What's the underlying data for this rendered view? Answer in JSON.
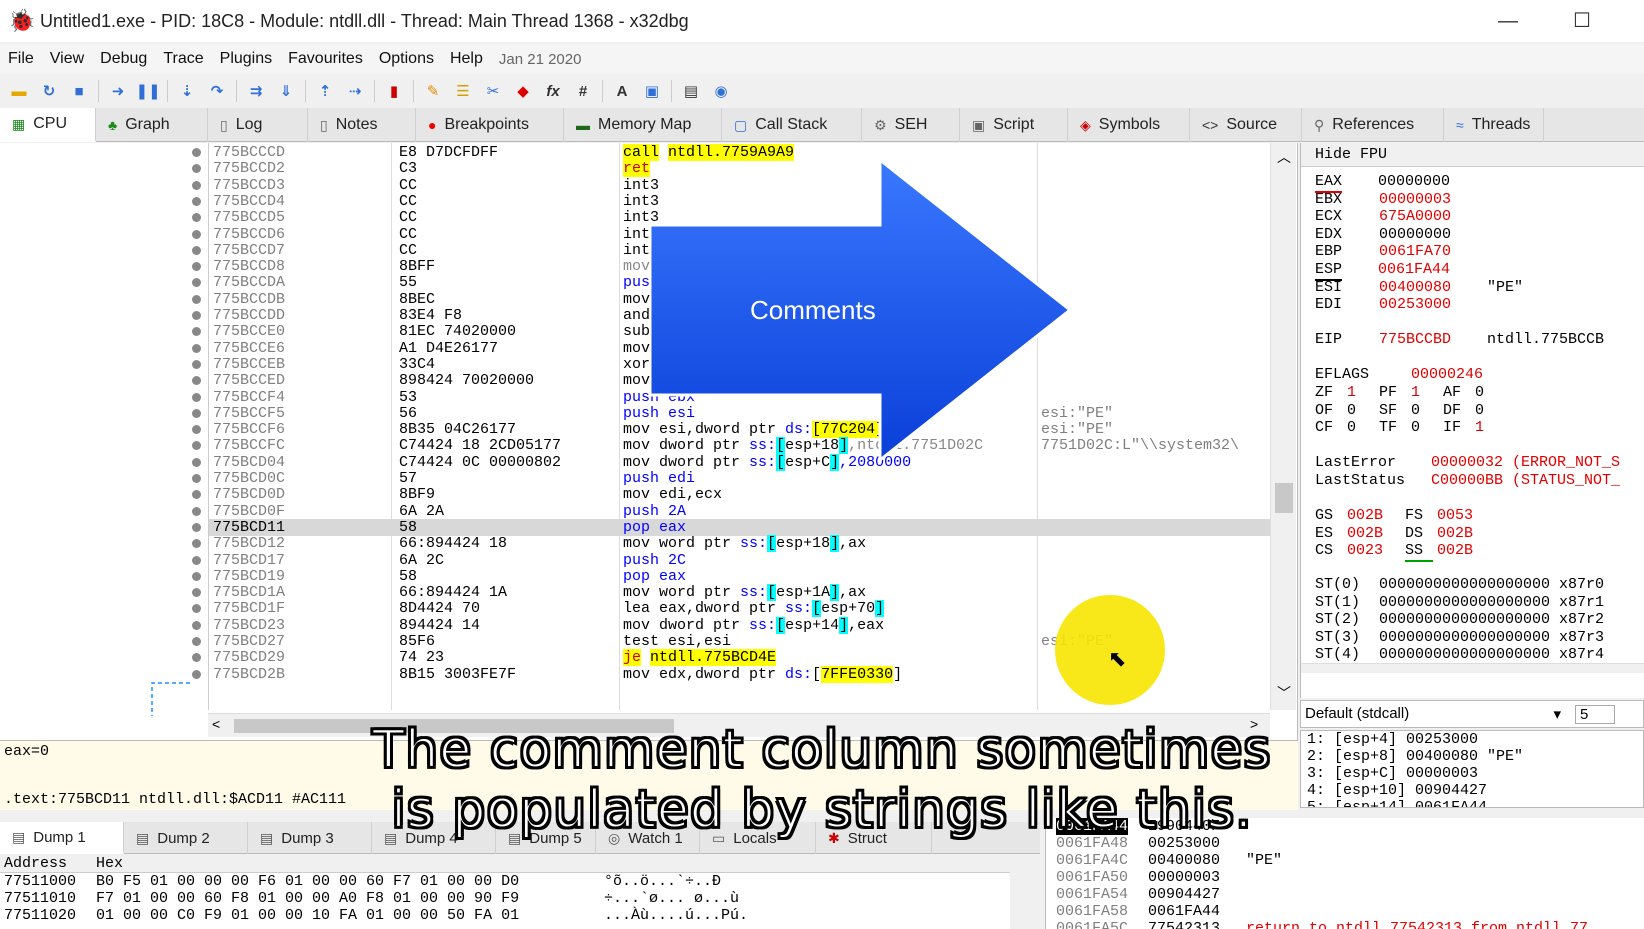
{
  "window": {
    "title": "Untitled1.exe - PID: 18C8 - Module: ntdll.dll - Thread: Main Thread 1368 - x32dbg",
    "minimize": "—",
    "maximize": "☐"
  },
  "menu": {
    "items": [
      "File",
      "View",
      "Debug",
      "Trace",
      "Plugins",
      "Favourites",
      "Options",
      "Help"
    ],
    "date": "Jan 21 2020"
  },
  "toolbar": {
    "fx": "fx",
    "hash": "#",
    "font": "A"
  },
  "tabs": [
    {
      "label": "CPU",
      "icon": "cpu-icon"
    },
    {
      "label": "Graph",
      "icon": "graph-icon"
    },
    {
      "label": "Log",
      "icon": "log-icon"
    },
    {
      "label": "Notes",
      "icon": "notes-icon"
    },
    {
      "label": "Breakpoints",
      "icon": "breakpoint-icon"
    },
    {
      "label": "Memory Map",
      "icon": "memory-icon"
    },
    {
      "label": "Call Stack",
      "icon": "callstack-icon"
    },
    {
      "label": "SEH",
      "icon": "seh-icon"
    },
    {
      "label": "Script",
      "icon": "script-icon"
    },
    {
      "label": "Symbols",
      "icon": "symbols-icon"
    },
    {
      "label": "Source",
      "icon": "source-icon"
    },
    {
      "label": "References",
      "icon": "references-icon"
    },
    {
      "label": "Threads",
      "icon": "threads-icon"
    }
  ],
  "disasm": {
    "rows": [
      {
        "addr": "775BCCCD",
        "bytes": "E8 D7DCFDFF",
        "instr_parts": [
          {
            "t": "call",
            "c": "kw-call"
          },
          {
            "t": " "
          },
          {
            "t": "ntdll.7759A9A9",
            "c": "hl-yellow"
          }
        ],
        "cmt": ""
      },
      {
        "addr": "775BCCD2",
        "bytes": "C3",
        "instr_parts": [
          {
            "t": "ret",
            "c": "kw-ret"
          }
        ],
        "cmt": ""
      },
      {
        "addr": "775BCCD3",
        "bytes": "CC",
        "instr_parts": [
          {
            "t": "int3"
          }
        ],
        "cmt": ""
      },
      {
        "addr": "775BCCD4",
        "bytes": "CC",
        "instr_parts": [
          {
            "t": "int3"
          }
        ],
        "cmt": ""
      },
      {
        "addr": "775BCCD5",
        "bytes": "CC",
        "instr_parts": [
          {
            "t": "int3"
          }
        ],
        "cmt": ""
      },
      {
        "addr": "775BCCD6",
        "bytes": "CC",
        "instr_parts": [
          {
            "t": "int3"
          }
        ],
        "cmt": ""
      },
      {
        "addr": "775BCCD7",
        "bytes": "CC",
        "instr_parts": [
          {
            "t": "int3"
          }
        ],
        "cmt": ""
      },
      {
        "addr": "775BCCD8",
        "bytes": "8BFF",
        "instr_parts": [
          {
            "t": "mov edi,edi",
            "c": "muted"
          }
        ],
        "cmt": ""
      },
      {
        "addr": "775BCCDA",
        "bytes": "55",
        "instr_parts": [
          {
            "t": "push ebp",
            "c": "kw-push"
          }
        ],
        "cmt": ""
      },
      {
        "addr": "775BCCDB",
        "bytes": "8BEC",
        "instr_parts": [
          {
            "t": "mov ebp,esp"
          }
        ],
        "cmt": ""
      },
      {
        "addr": "775BCCDD",
        "bytes": "83E4 F8",
        "instr_parts": [
          {
            "t": "and esp,FFFFFFF8"
          }
        ],
        "cmt": ""
      },
      {
        "addr": "775BCCE0",
        "bytes": "81EC 74020000",
        "instr_parts": [
          {
            "t": "sub esp,274"
          }
        ],
        "cmt": ""
      },
      {
        "addr": "775BCCE6",
        "bytes": "A1 D4E26177",
        "instr_parts": [
          {
            "t": "mov eax,dword ptr ds:[7761E2D4]"
          }
        ],
        "cmt": ""
      },
      {
        "addr": "775BCCEB",
        "bytes": "33C4",
        "instr_parts": [
          {
            "t": "xor eax,esp"
          }
        ],
        "cmt": ""
      },
      {
        "addr": "775BCCED",
        "bytes": "898424 70020000",
        "instr_parts": [
          {
            "t": "mov dword ptr "
          },
          {
            "t": "ss:",
            "c": "kw-seg"
          },
          {
            "t": "[",
            "c": "bracket"
          },
          {
            "t": "esp+27",
            "c": "kw-seg"
          }
        ],
        "cmt": ""
      },
      {
        "addr": "775BCCF4",
        "bytes": "53",
        "instr_parts": [
          {
            "t": "push ebx",
            "c": "kw-push"
          }
        ],
        "cmt": ""
      },
      {
        "addr": "775BCCF5",
        "bytes": "56",
        "instr_parts": [
          {
            "t": "push esi",
            "c": "kw-push"
          }
        ],
        "cmt": "esi:\"PE\""
      },
      {
        "addr": "775BCCF6",
        "bytes": "8B35 04C26177",
        "instr_parts": [
          {
            "t": "mov esi,dword ptr "
          },
          {
            "t": "ds:",
            "c": "kw-seg"
          },
          {
            "t": "[77",
            "c": "hl-yellow"
          },
          {
            "t": "C204]",
            "c": "hl-yellow"
          }
        ],
        "cmt": "esi:\"PE\""
      },
      {
        "addr": "775BCCFC",
        "bytes": "C74424 18 2CD05177",
        "instr_parts": [
          {
            "t": "mov dword ptr "
          },
          {
            "t": "ss:",
            "c": "kw-seg"
          },
          {
            "t": "[",
            "c": "bracket"
          },
          {
            "t": "esp+18"
          },
          {
            "t": "]",
            "c": "bracket"
          },
          {
            "t": ",ntdll.7751D02C",
            "c": "muted"
          }
        ],
        "cmt": "7751D02C:L\"\\\\system32\\"
      },
      {
        "addr": "775BCD04",
        "bytes": "C74424 0C 00000802",
        "instr_parts": [
          {
            "t": "mov dword ptr "
          },
          {
            "t": "ss:",
            "c": "kw-seg"
          },
          {
            "t": "[",
            "c": "bracket"
          },
          {
            "t": "esp+C"
          },
          {
            "t": "]",
            "c": "bracket"
          },
          {
            "t": ",2080000",
            "c": "kw-seg"
          }
        ],
        "cmt": ""
      },
      {
        "addr": "775BCD0C",
        "bytes": "57",
        "instr_parts": [
          {
            "t": "push edi",
            "c": "kw-push"
          }
        ],
        "cmt": ""
      },
      {
        "addr": "775BCD0D",
        "bytes": "8BF9",
        "instr_parts": [
          {
            "t": "mov edi,ecx"
          }
        ],
        "cmt": ""
      },
      {
        "addr": "775BCD0F",
        "bytes": "6A 2A",
        "instr_parts": [
          {
            "t": "push 2A",
            "c": "kw-push"
          }
        ],
        "cmt": ""
      },
      {
        "addr": "775BCD11",
        "bytes": "58",
        "instr_parts": [
          {
            "t": "pop eax",
            "c": "kw-push"
          }
        ],
        "cmt": "",
        "selected": true
      },
      {
        "addr": "775BCD12",
        "bytes": "66:894424 18",
        "instr_parts": [
          {
            "t": "mov word ptr "
          },
          {
            "t": "ss:",
            "c": "kw-seg"
          },
          {
            "t": "[",
            "c": "bracket"
          },
          {
            "t": "esp+18"
          },
          {
            "t": "]",
            "c": "bracket"
          },
          {
            "t": ",ax"
          }
        ],
        "cmt": ""
      },
      {
        "addr": "775BCD17",
        "bytes": "6A 2C",
        "instr_parts": [
          {
            "t": "push 2C",
            "c": "kw-push"
          }
        ],
        "cmt": ""
      },
      {
        "addr": "775BCD19",
        "bytes": "58",
        "instr_parts": [
          {
            "t": "pop eax",
            "c": "kw-push"
          }
        ],
        "cmt": ""
      },
      {
        "addr": "775BCD1A",
        "bytes": "66:894424 1A",
        "instr_parts": [
          {
            "t": "mov word ptr "
          },
          {
            "t": "ss:",
            "c": "kw-seg"
          },
          {
            "t": "[",
            "c": "bracket"
          },
          {
            "t": "esp+1A"
          },
          {
            "t": "]",
            "c": "bracket"
          },
          {
            "t": ",ax"
          }
        ],
        "cmt": ""
      },
      {
        "addr": "775BCD1F",
        "bytes": "8D4424 70",
        "instr_parts": [
          {
            "t": "lea eax,dword ptr "
          },
          {
            "t": "ss:",
            "c": "kw-seg"
          },
          {
            "t": "[",
            "c": "bracket"
          },
          {
            "t": "esp+70"
          },
          {
            "t": "]",
            "c": "bracket"
          }
        ],
        "cmt": ""
      },
      {
        "addr": "775BCD23",
        "bytes": "894424 14",
        "instr_parts": [
          {
            "t": "mov dword ptr "
          },
          {
            "t": "ss:",
            "c": "kw-seg"
          },
          {
            "t": "[",
            "c": "bracket"
          },
          {
            "t": "esp+14"
          },
          {
            "t": "]",
            "c": "bracket"
          },
          {
            "t": ",eax"
          }
        ],
        "cmt": ""
      },
      {
        "addr": "775BCD27",
        "bytes": "85F6",
        "instr_parts": [
          {
            "t": "test esi,esi"
          }
        ],
        "cmt": "esi:\"PE\""
      },
      {
        "addr": "775BCD29",
        "bytes": "74 23",
        "instr_parts": [
          {
            "t": "je",
            "c": "kw-jcc"
          },
          {
            "t": " "
          },
          {
            "t": "ntdll.775BCD4E",
            "c": "hl-yellow"
          }
        ],
        "cmt": ""
      },
      {
        "addr": "775BCD2B",
        "bytes": "8B15 3003FE7F",
        "instr_parts": [
          {
            "t": "mov edx,dword ptr "
          },
          {
            "t": "ds:",
            "c": "kw-seg"
          },
          {
            "t": "["
          },
          {
            "t": "7FFE0330",
            "c": "hl-yellow"
          },
          {
            "t": "]"
          }
        ],
        "cmt": ""
      }
    ]
  },
  "overlay": {
    "arrow_label": "Comments"
  },
  "registers": {
    "header": "Hide FPU",
    "gp": [
      {
        "name": "EAX",
        "value": "00000000",
        "red": false,
        "cmt": "",
        "ul": "red"
      },
      {
        "name": "EBX",
        "value": "00000003",
        "red": true,
        "cmt": ""
      },
      {
        "name": "ECX",
        "value": "675A0000",
        "red": true,
        "cmt": ""
      },
      {
        "name": "EDX",
        "value": "00000000",
        "red": false,
        "cmt": ""
      },
      {
        "name": "EBP",
        "value": "0061FA70",
        "red": true,
        "cmt": ""
      },
      {
        "name": "ESP",
        "value": "0061FA44",
        "red": true,
        "cmt": "",
        "ul": "plain"
      },
      {
        "name": "ESI",
        "value": "00400080",
        "red": true,
        "cmt": "\"PE\""
      },
      {
        "name": "EDI",
        "value": "00253000",
        "red": true,
        "cmt": ""
      }
    ],
    "eip": {
      "name": "EIP",
      "value": "775BCCBD",
      "cmt": "ntdll.775BCCB"
    },
    "eflags": {
      "name": "EFLAGS",
      "value": "00000246"
    },
    "flags": [
      [
        {
          "n": "ZF",
          "v": "1",
          "red": true
        },
        {
          "n": "PF",
          "v": "1",
          "red": true
        },
        {
          "n": "AF",
          "v": "0",
          "red": false
        }
      ],
      [
        {
          "n": "OF",
          "v": "0",
          "red": false
        },
        {
          "n": "SF",
          "v": "0",
          "red": false
        },
        {
          "n": "DF",
          "v": "0",
          "red": false
        }
      ],
      [
        {
          "n": "CF",
          "v": "0",
          "red": false
        },
        {
          "n": "TF",
          "v": "0",
          "red": false
        },
        {
          "n": "IF",
          "v": "1",
          "red": true
        }
      ]
    ],
    "last_error": {
      "name": "LastError",
      "value": "00000032 (ERROR_NOT_S"
    },
    "last_status": {
      "name": "LastStatus",
      "value": "C00000BB (STATUS_NOT_"
    },
    "segs": [
      [
        {
          "n": "GS",
          "v": "002B"
        },
        {
          "n": "FS",
          "v": "0053"
        }
      ],
      [
        {
          "n": "ES",
          "v": "002B"
        },
        {
          "n": "DS",
          "v": "002B"
        }
      ],
      [
        {
          "n": "CS",
          "v": "0023"
        },
        {
          "n": "SS",
          "v": "002B"
        }
      ]
    ],
    "fpu": [
      {
        "name": "ST(0)",
        "value": "0000000000000000000 x87r0"
      },
      {
        "name": "ST(1)",
        "value": "0000000000000000000 x87r1"
      },
      {
        "name": "ST(2)",
        "value": "0000000000000000000 x87r2"
      },
      {
        "name": "ST(3)",
        "value": "0000000000000000000 x87r3"
      },
      {
        "name": "ST(4)",
        "value": "0000000000000000000 x87r4"
      }
    ]
  },
  "callconv": {
    "selected": "Default (stdcall)",
    "count": "5"
  },
  "args": [
    "1: [esp+4] 00253000",
    "2: [esp+8] 00400080 \"PE\"",
    "3: [esp+C] 00000003",
    "4: [esp+10] 00904427",
    "5: [esp+14] 0061FA44"
  ],
  "info": {
    "line1": "eax=0",
    "line2": ".text:775BCD11 ntdll.dll:$ACD11 #AC111"
  },
  "dump_tabs": [
    "Dump 1",
    "Dump 2",
    "Dump 3",
    "Dump 4",
    "Dump 5",
    "Watch 1",
    "Locals",
    "Struct"
  ],
  "dump": {
    "header_address": "Address",
    "header_hex": "Hex",
    "rows": [
      {
        "addr": "77511000",
        "hex": "B0 F5 01 00 00 00 F6 01 00 00 60 F7 01 00 00 D0",
        "ascii": "°õ..ö...`÷..Ð"
      },
      {
        "addr": "77511010",
        "hex": "F7 01 00 00 60 F8 01 00 00 A0 F8 01 00 00 90 F9",
        "ascii": "÷...`ø... ø...ù"
      },
      {
        "addr": "77511020",
        "hex": "01 00 00 C0 F9 01 00 00 10 FA 01 00 00 50 FA 01",
        "ascii": "...Àù....ú...Pú."
      }
    ]
  },
  "stack": [
    {
      "addr": "0061FA44",
      "val": "E990440F",
      "cmt": "",
      "top": true
    },
    {
      "addr": "0061FA48",
      "val": "00253000",
      "cmt": ""
    },
    {
      "addr": "0061FA4C",
      "val": "00400080",
      "cmt": "\"PE\""
    },
    {
      "addr": "0061FA50",
      "val": "00000003",
      "cmt": ""
    },
    {
      "addr": "0061FA54",
      "val": "00904427",
      "cmt": ""
    },
    {
      "addr": "0061FA58",
      "val": "0061FA44",
      "cmt": ""
    },
    {
      "addr": "0061FA5C",
      "val": "77542313",
      "cmt": "return to ntdll.77542313 from ntdll.77",
      "red": true
    }
  ],
  "subtitles": {
    "line1": "The comment column sometimes",
    "line2": "is populated by strings like this."
  }
}
